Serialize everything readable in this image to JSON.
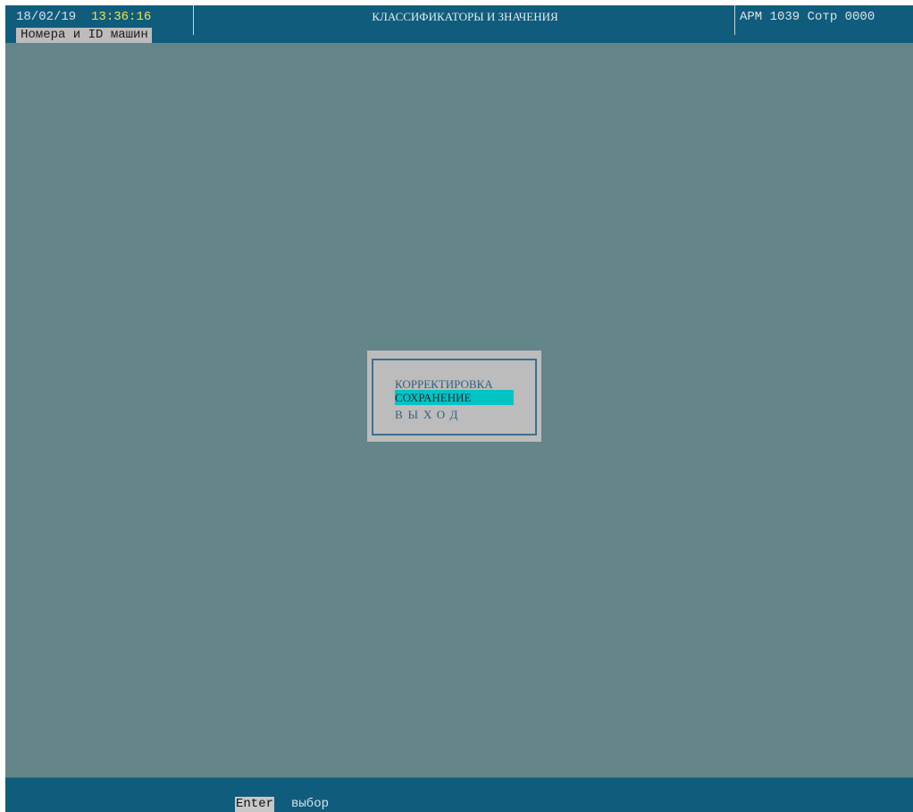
{
  "header": {
    "date": "18/02/19",
    "time": "13:36:16",
    "title": "КЛАССИФИКАТОРЫ И ЗНАЧЕНИЯ",
    "workstation": "АРМ 1039 Сотр 0000"
  },
  "tab": {
    "label": "Номера и ID машин"
  },
  "menu": {
    "items": [
      {
        "label": "КОРРЕКТИРОВКА",
        "selected": false
      },
      {
        "label": "СОХРАНЕНИЕ",
        "selected": true
      },
      {
        "label": "ВЫХОД",
        "selected": false
      }
    ]
  },
  "footer": {
    "hint_key": "Enter",
    "hint_label": "выбор"
  },
  "colors": {
    "background": "#648589",
    "bar": "#105c7c",
    "selection": "#00c4c4",
    "dialog": "#bcbcbc",
    "time_text": "#e8e84a"
  }
}
